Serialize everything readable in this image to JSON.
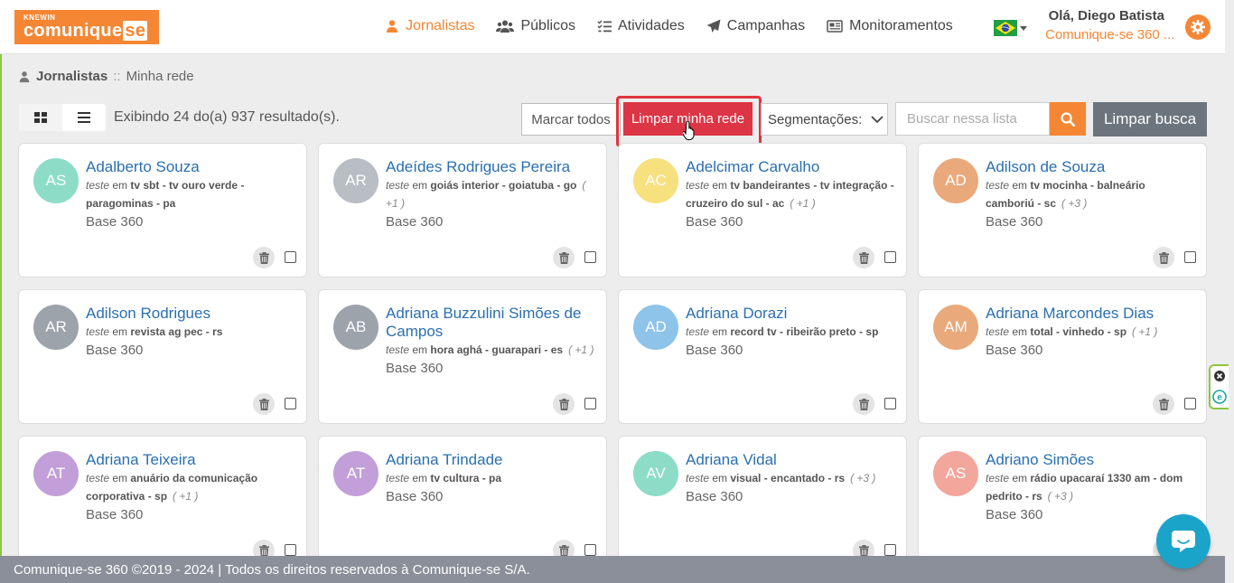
{
  "header": {
    "logo_small": "KNEWIN",
    "logo_main": "comunique",
    "logo_se": "se",
    "nav": [
      {
        "label": "Jornalistas",
        "icon": "user-icon",
        "active": true
      },
      {
        "label": "Públicos",
        "icon": "users-icon",
        "active": false
      },
      {
        "label": "Atividades",
        "icon": "tasks-icon",
        "active": false
      },
      {
        "label": "Campanhas",
        "icon": "paper-plane-icon",
        "active": false
      },
      {
        "label": "Monitoramentos",
        "icon": "newspaper-icon",
        "active": false
      }
    ],
    "greeting": "Olá, Diego Batista",
    "organization": "Comunique-se 360 ..."
  },
  "breadcrumb": {
    "section": "Jornalistas",
    "separator": "::",
    "page": "Minha rede"
  },
  "toolbar": {
    "result_text": "Exibindo 24 do(a) 937 resultado(s).",
    "mark_all": "Marcar todos",
    "clear_network": "Limpar minha rede",
    "segmentations": "Segmentações:",
    "search_placeholder": "Buscar nessa lista",
    "clear_search": "Limpar busca"
  },
  "cards": [
    {
      "initials": "AS",
      "color": "#8ddcc8",
      "name": "Adalberto Souza",
      "prefix": "teste",
      "em": "em",
      "outlet": "tv sbt - tv ouro verde - paragominas - pa",
      "more": "",
      "base": "Base 360"
    },
    {
      "initials": "AR",
      "color": "#b9bec5",
      "name": "Adeídes Rodrigues Pereira",
      "prefix": "teste",
      "em": "em",
      "outlet": "goiás interior - goiatuba - go",
      "more": "( +1 )",
      "base": "Base 360"
    },
    {
      "initials": "AC",
      "color": "#f7e07e",
      "name": "Adelcimar Carvalho",
      "prefix": "teste",
      "em": "em",
      "outlet": "tv bandeirantes - tv integração - cruzeiro do sul - ac",
      "more": "( +1 )",
      "base": "Base 360"
    },
    {
      "initials": "AD",
      "color": "#e9a97a",
      "name": "Adilson de Souza",
      "prefix": "teste",
      "em": "em",
      "outlet": "tv mocinha - balneário camboriú - sc",
      "more": "( +3 )",
      "base": "Base 360"
    },
    {
      "initials": "AR",
      "color": "#9da3ab",
      "name": "Adilson Rodrigues",
      "prefix": "teste",
      "em": "em",
      "outlet": "revista ag pec - rs",
      "more": "",
      "base": "Base 360"
    },
    {
      "initials": "AB",
      "color": "#9da3ab",
      "name": "Adriana Buzzulini Simões de Campos",
      "prefix": "teste",
      "em": "em",
      "outlet": "hora aghá - guarapari - es",
      "more": "( +1 )",
      "base": "Base 360"
    },
    {
      "initials": "AD",
      "color": "#8ec3ea",
      "name": "Adriana Dorazi",
      "prefix": "teste",
      "em": "em",
      "outlet": "record tv - ribeirão preto - sp",
      "more": "",
      "base": "Base 360"
    },
    {
      "initials": "AM",
      "color": "#e9a97a",
      "name": "Adriana Marcondes Dias",
      "prefix": "teste",
      "em": "em",
      "outlet": "total - vinhedo - sp",
      "more": "( +1 )",
      "base": "Base 360"
    },
    {
      "initials": "AT",
      "color": "#c29fd8",
      "name": "Adriana Teixeira",
      "prefix": "teste",
      "em": "em",
      "outlet": "anuário da comunicação corporativa - sp",
      "more": "( +1 )",
      "base": "Base 360"
    },
    {
      "initials": "AT",
      "color": "#c29fd8",
      "name": "Adriana Trindade",
      "prefix": "teste",
      "em": "em",
      "outlet": "tv cultura - pa",
      "more": "",
      "base": "Base 360"
    },
    {
      "initials": "AV",
      "color": "#8ddcc8",
      "name": "Adriana Vidal",
      "prefix": "teste",
      "em": "em",
      "outlet": "visual - encantado - rs",
      "more": "( +3 )",
      "base": "Base 360"
    },
    {
      "initials": "AS",
      "color": "#f2a69c",
      "name": "Adriano Simões",
      "prefix": "teste",
      "em": "em",
      "outlet": "rádio upacaraí 1330 am - dom pedrito - rs",
      "more": "( +3 )",
      "base": "Base 360"
    }
  ],
  "footer": {
    "text": "Comunique-se 360 ©2019 - 2024 | Todos os direitos reservados à Comunique-se S/A."
  },
  "colors": {
    "brand_orange": "#f58634",
    "danger_red": "#dc3545",
    "link_blue": "#2a6fb0",
    "footer_gray": "#8a8f99",
    "chat_blue": "#1ba4c9"
  }
}
